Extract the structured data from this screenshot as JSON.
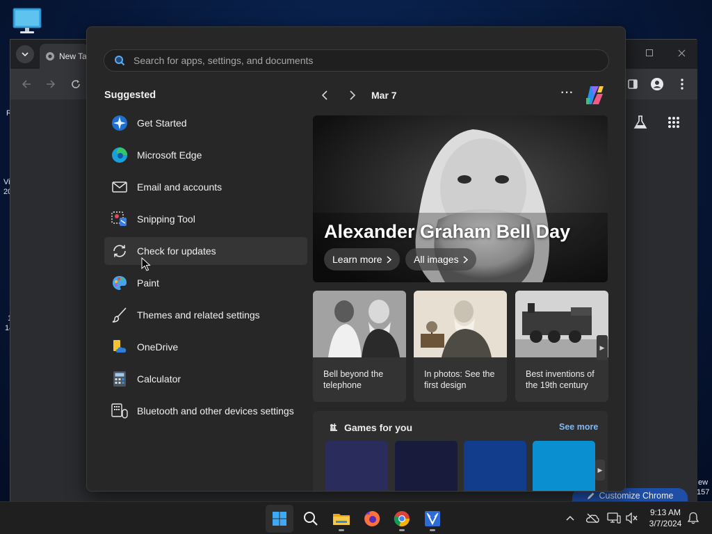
{
  "desktop": {
    "edge_texts": [
      "R",
      "Vi",
      "20",
      "1",
      "14",
      "ew",
      "157"
    ]
  },
  "chrome": {
    "tab_title": "New Ta",
    "customize_label": "Customize Chrome",
    "accent": "#1f4ea6"
  },
  "start_menu": {
    "search_placeholder": "Search for apps, settings, and documents",
    "suggested_title": "Suggested",
    "suggested_items": [
      {
        "label": "Get Started",
        "icon": "get-started-icon"
      },
      {
        "label": "Microsoft Edge",
        "icon": "edge-icon"
      },
      {
        "label": "Email and accounts",
        "icon": "mail-icon"
      },
      {
        "label": "Snipping Tool",
        "icon": "snipping-tool-icon"
      },
      {
        "label": "Check for updates",
        "icon": "refresh-icon"
      },
      {
        "label": "Paint",
        "icon": "paint-icon"
      },
      {
        "label": "Themes and related settings",
        "icon": "brush-icon"
      },
      {
        "label": "OneDrive",
        "icon": "onedrive-icon"
      },
      {
        "label": "Calculator",
        "icon": "calculator-icon"
      },
      {
        "label": "Bluetooth and other devices settings",
        "icon": "devices-icon"
      }
    ],
    "hovered_item": "Check for updates"
  },
  "widgets": {
    "date": "Mar 7",
    "hero": {
      "title": "Alexander Graham Bell Day",
      "learn_more": "Learn more",
      "all_images": "All images"
    },
    "cards": [
      {
        "text": "Bell beyond the telephone"
      },
      {
        "text": "In photos: See the first design"
      },
      {
        "text": "Best inventions of the 19th century"
      }
    ],
    "games": {
      "title": "Games for you",
      "see_more": "See more",
      "tile_colors": [
        "#2a2d5c",
        "#181b3c",
        "#123d8c",
        "#0a8fd0"
      ]
    }
  },
  "taskbar": {
    "apps": [
      "start-icon",
      "search-icon",
      "file-explorer-icon",
      "firefox-icon",
      "chrome-icon",
      "app-icon"
    ],
    "time": "9:13 AM",
    "date": "3/7/2024"
  }
}
